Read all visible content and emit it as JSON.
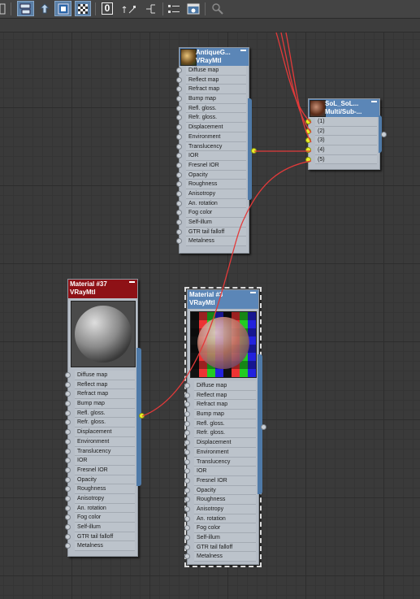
{
  "toolbar": {
    "icons": [
      "partial-icon",
      "layout-icon",
      "move-children-icon",
      "show-map-in-viewport-icon",
      "show-background-icon",
      "zero-icon",
      "lay-out-children-icon",
      "hierarchy-icon",
      "list-icon",
      "material-map-browser-icon",
      "search-icon"
    ],
    "zero_label": "0"
  },
  "nodes": {
    "antique": {
      "title": "AntiqueG...",
      "subtitle": "VRayMtl",
      "slots": [
        "Diffuse map",
        "Reflect map",
        "Refract map",
        "Bump map",
        "Refl. gloss.",
        "Refr. gloss.",
        "Displacement",
        "Environment",
        "Translucency",
        "IOR",
        "Fresnel IOR",
        "Opacity",
        "Roughness",
        "Anisotropy",
        "An. rotation",
        "Fog color",
        "Self-illum",
        "GTR tail falloff",
        "Metalness"
      ]
    },
    "multi": {
      "title": "SoL_SoL...",
      "subtitle": "Multi/Sub-...",
      "slots": [
        "(1)",
        "(2)",
        "(3)",
        "(4)",
        "(5)"
      ]
    },
    "mat37": {
      "title": "Material #37",
      "subtitle": "VRayMtl",
      "slots": [
        "Diffuse map",
        "Reflect map",
        "Refract map",
        "Bump map",
        "Refl. gloss.",
        "Refr. gloss.",
        "Displacement",
        "Environment",
        "Translucency",
        "IOR",
        "Fresnel IOR",
        "Opacity",
        "Roughness",
        "Anisotropy",
        "An. rotation",
        "Fog color",
        "Self-illum",
        "GTR tail falloff",
        "Metalness"
      ]
    },
    "mat3x": {
      "title": "Material #3",
      "subtitle": "VRayMtl",
      "slots": [
        "Diffuse map",
        "Reflect map",
        "Refract map",
        "Bump map",
        "Refl. gloss.",
        "Refr. gloss.",
        "Displacement",
        "Environment",
        "Translucency",
        "IOR",
        "Fresnel IOR",
        "Opacity",
        "Roughness",
        "Anisotropy",
        "An. rotation",
        "Fog color",
        "Self-illum",
        "GTR tail falloff",
        "Metalness"
      ]
    }
  },
  "colors": {
    "header_blue": "#5b86b7",
    "header_red": "#8e1116",
    "socket_active": "#e8f02a",
    "wire": "#e23a3a"
  }
}
